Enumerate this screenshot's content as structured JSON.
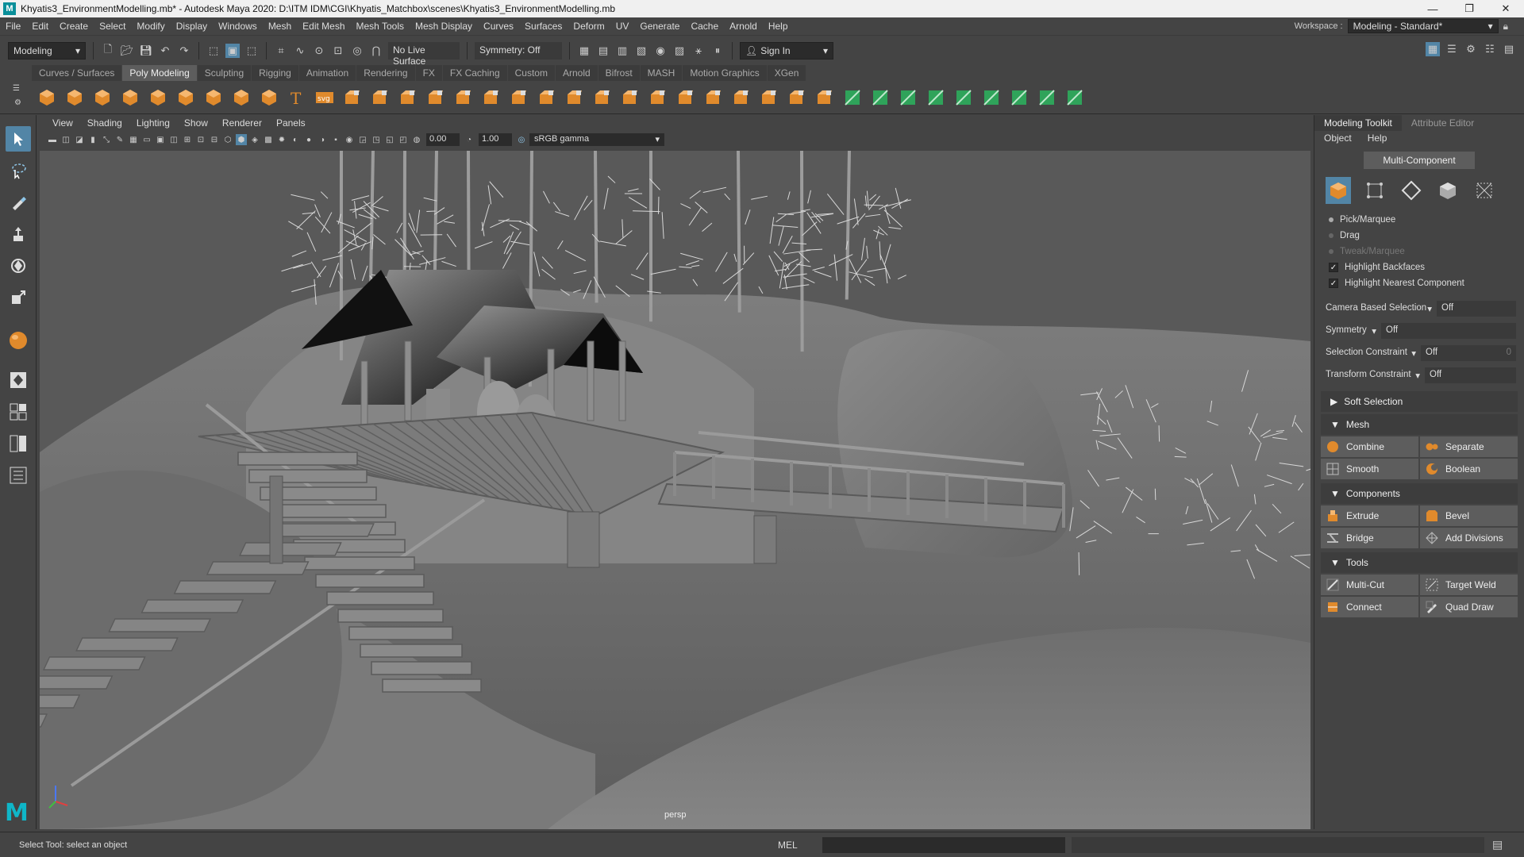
{
  "window": {
    "title": "Khyatis3_EnvironmentModelling.mb* - Autodesk Maya 2020: D:\\ITM IDM\\CGI\\Khyatis_Matchbox\\scenes\\Khyatis3_EnvironmentModelling.mb"
  },
  "menubar": {
    "items": [
      "File",
      "Edit",
      "Create",
      "Select",
      "Modify",
      "Display",
      "Windows",
      "Mesh",
      "Edit Mesh",
      "Mesh Tools",
      "Mesh Display",
      "Curves",
      "Surfaces",
      "Deform",
      "UV",
      "Generate",
      "Cache",
      "Arnold",
      "Help"
    ],
    "workspace_label": "Workspace :",
    "workspace_value": "Modeling - Standard*"
  },
  "statusline": {
    "menuset": "Modeling",
    "live_surface": "No Live Surface",
    "symmetry": "Symmetry: Off",
    "sign_in": "Sign In"
  },
  "shelf": {
    "tabs": [
      "Curves / Surfaces",
      "Poly Modeling",
      "Sculpting",
      "Rigging",
      "Animation",
      "Rendering",
      "FX",
      "FX Caching",
      "Custom",
      "Arnold",
      "Bifrost",
      "MASH",
      "Motion Graphics",
      "XGen"
    ],
    "active_tab": "Poly Modeling",
    "icons": [
      "sphere-icon",
      "cube-icon",
      "cylinder-icon",
      "cone-icon",
      "torus-icon",
      "plane-icon",
      "disc-icon",
      "platonic-icon",
      "sweep-icon",
      "type-icon",
      "svg-icon",
      "sphere-uv-icon",
      "bevel-icon",
      "extrude-icon",
      "bridge-icon",
      "append-icon",
      "fill-hole-icon",
      "combine-icon",
      "separate-icon",
      "smooth-icon",
      "boolean-icon",
      "mirror-icon",
      "reduce-icon",
      "remesh-icon",
      "retopo-icon",
      "uv-icon",
      "multi-cut-icon",
      "target-weld-icon",
      "quad-draw-icon",
      "connect-icon",
      "planar-uv-icon",
      "auto-uv-icon",
      "uv-editor-icon",
      "unfold-icon",
      "layout-icon",
      "checker-icon",
      "sew-icon",
      "cut-icon"
    ]
  },
  "panel": {
    "menu": [
      "View",
      "Shading",
      "Lighting",
      "Show",
      "Renderer",
      "Panels"
    ],
    "exposure": "0.00",
    "gamma_value": "1.00",
    "color_space": "sRGB gamma",
    "camera_label": "persp"
  },
  "toolkit": {
    "tabs": [
      "Modeling Toolkit",
      "Attribute Editor"
    ],
    "menu": [
      "Object",
      "Help"
    ],
    "multi_component": "Multi-Component",
    "selection_options": {
      "pick_marquee": "Pick/Marquee",
      "drag": "Drag",
      "tweak_marquee": "Tweak/Marquee",
      "highlight_backfaces": "Highlight Backfaces",
      "highlight_nearest": "Highlight Nearest Component"
    },
    "props": {
      "camera_based_label": "Camera Based Selection",
      "camera_based_value": "Off",
      "symmetry_label": "Symmetry",
      "symmetry_value": "Off",
      "selection_constraint_label": "Selection Constraint",
      "selection_constraint_value": "Off",
      "selection_constraint_num": "0",
      "transform_constraint_label": "Transform Constraint",
      "transform_constraint_value": "Off"
    },
    "soft_selection": "Soft Selection",
    "sections": {
      "mesh": {
        "title": "Mesh",
        "buttons": [
          "Combine",
          "Separate",
          "Smooth",
          "Boolean"
        ]
      },
      "components": {
        "title": "Components",
        "buttons": [
          "Extrude",
          "Bevel",
          "Bridge",
          "Add Divisions"
        ]
      },
      "tools": {
        "title": "Tools",
        "buttons": [
          "Multi-Cut",
          "Target Weld",
          "Connect",
          "Quad Draw"
        ]
      }
    }
  },
  "helpline": {
    "text": "Select Tool: select an object",
    "mel_label": "MEL"
  },
  "colors": {
    "accent": "#5285a6",
    "shelf_orange": "#e08a2c",
    "shelf_green": "#2fa35a",
    "maya_teal": "#0fb6c8"
  }
}
